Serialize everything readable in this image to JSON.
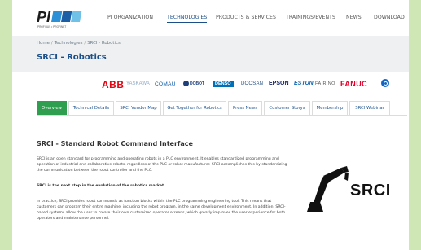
{
  "header": {
    "logo_text": "PI",
    "logo_subtitle": "PROFIBUS • PROFINET",
    "nav": [
      {
        "label": "PI ORGANIZATION",
        "active": false
      },
      {
        "label": "TECHNOLOGIES",
        "active": true
      },
      {
        "label": "PRODUCTS & SERVICES",
        "active": false
      },
      {
        "label": "TRAININGS/EVENTS",
        "active": false
      },
      {
        "label": "NEWS",
        "active": false
      },
      {
        "label": "DOWNLOAD",
        "active": false
      }
    ]
  },
  "breadcrumb": {
    "items": [
      "Home",
      "Technologies",
      "SRCI - Robotics"
    ],
    "separator": "/"
  },
  "page_title": "SRCI - Robotics",
  "partners": {
    "abb": "ABB",
    "yaskawa": "YASKAWA",
    "comau": "COMAU",
    "dobot": "DOBOT",
    "denso": "DENSO",
    "doosan": "DOOSAN",
    "epson": "EPSON",
    "estun": "ESTUN",
    "fairino": "FAIRINO",
    "fanuc": "FANUC"
  },
  "tabs": [
    {
      "label": "Overview",
      "active": true
    },
    {
      "label": "Technical Details",
      "active": false
    },
    {
      "label": "SRCI Vendor Map",
      "active": false
    },
    {
      "label": "Get Together for Robotics",
      "active": false
    },
    {
      "label": "Press News",
      "active": false
    },
    {
      "label": "Customer Storys",
      "active": false
    },
    {
      "label": "Membership",
      "active": false
    },
    {
      "label": "SRCI Webinar",
      "active": false
    }
  ],
  "content": {
    "title": "SRCI - Standard Robot Command Interface",
    "paragraph1": "SRCI is an open standard for programming and operating robots in a PLC environment. It enables standardized programming and operation of industrial and collaborative robots, regardless of the PLC or robot manufacturer. SRCI accomplishes this by standardizing the communication between the robot controller and the PLC.",
    "paragraph2": "SRCI is the next step in the evolution of the robotics market.",
    "paragraph3": "In practice, SRCI provides robot commands as function blocks within the PLC programming engineering tool. This means that customers can program their entire machine, including the robot program, in the same development environment. In addition, SRCI-based systems allow the user to create their own customized operator screens, which greatly improves the user experience for both operators and maintenance personnel.",
    "srci_logo_text": "SRCI"
  },
  "colors": {
    "accent_blue": "#1a4f8a",
    "tab_active_green": "#2f9e4f",
    "page_background": "#cfe7b5",
    "band_grey": "#eef0f1"
  }
}
